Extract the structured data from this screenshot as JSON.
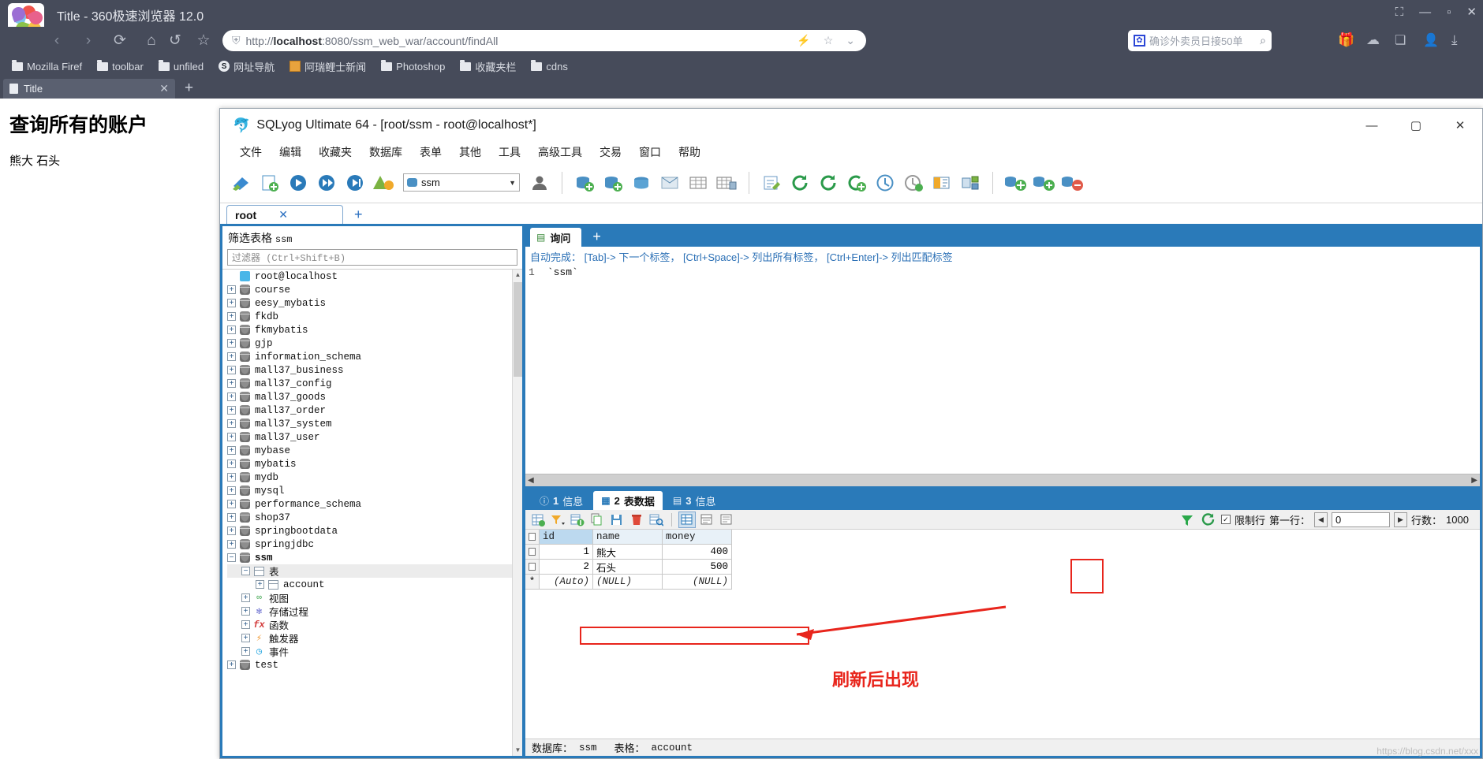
{
  "browser": {
    "window_title": "Title - 360极速浏览器 12.0",
    "nav": {
      "back": "‹",
      "forward": "›",
      "reload": "⟳",
      "home": "⌂",
      "undo": "↺",
      "star": "☆"
    },
    "url": {
      "scheme": "http://",
      "host": "localhost",
      "rest": ":8080/ssm_web_war/account/findAll"
    },
    "url_icons": {
      "lightning": "⚡",
      "star": "☆",
      "chevron": "⌄"
    },
    "search": {
      "placeholder": "确诊外卖员日接50单",
      "magnifier": "⌕"
    },
    "window_controls": {
      "screenshot": "⛶",
      "minimize": "—",
      "maximize": "▫",
      "close": "✕"
    },
    "bookmarks": [
      {
        "label": "Mozilla Firef",
        "icon": "folder-icon"
      },
      {
        "label": "toolbar",
        "icon": "folder-icon"
      },
      {
        "label": "unfiled",
        "icon": "folder-icon"
      },
      {
        "label": "网址导航",
        "icon": "compass-icon"
      },
      {
        "label": "阿瑞鲤士新闻",
        "icon": "news-icon"
      },
      {
        "label": "Photoshop",
        "icon": "folder-icon"
      },
      {
        "label": "收藏夹栏",
        "icon": "folder-icon"
      },
      {
        "label": "cdns",
        "icon": "folder-icon"
      }
    ],
    "tab": {
      "label": "Title",
      "close": "✕"
    },
    "new_tab": "+"
  },
  "page": {
    "heading": "查询所有的账户",
    "names": "熊大 石头"
  },
  "sqlyog": {
    "title": "SQLyog Ultimate 64 - [root/ssm - root@localhost*]",
    "window_controls": {
      "minimize": "—",
      "maximize": "▢",
      "close": "✕"
    },
    "menus": [
      "文件",
      "编辑",
      "收藏夹",
      "数据库",
      "表单",
      "其他",
      "工具",
      "高级工具",
      "交易",
      "窗口",
      "帮助"
    ],
    "db_selector": {
      "value": "ssm",
      "arrow": "▼"
    },
    "connection_tab": {
      "label": "root",
      "close": "✕"
    },
    "connection_new": "+",
    "tree": {
      "filter_label": "筛选表格",
      "filter_db": "ssm",
      "filter_placeholder": "过滤器 (Ctrl+Shift+B)",
      "root": "root@localhost",
      "databases": [
        "course",
        "eesy_mybatis",
        "fkdb",
        "fkmybatis",
        "gjp",
        "information_schema",
        "mall37_business",
        "mall37_config",
        "mall37_goods",
        "mall37_order",
        "mall37_system",
        "mall37_user",
        "mybase",
        "mybatis",
        "mydb",
        "mysql",
        "performance_schema",
        "shop37",
        "springbootdata",
        "springjdbc"
      ],
      "selected_db": "ssm",
      "ssm_children": [
        {
          "label": "表",
          "icon": "table-icon",
          "expanded": true
        },
        {
          "label": "视图",
          "icon": "view-icon",
          "expanded": false
        },
        {
          "label": "存储过程",
          "icon": "procedure-icon",
          "expanded": false
        },
        {
          "label": "函数",
          "icon": "function-icon",
          "expanded": false
        },
        {
          "label": "触发器",
          "icon": "trigger-icon",
          "expanded": false
        },
        {
          "label": "事件",
          "icon": "event-icon",
          "expanded": false
        }
      ],
      "tables": [
        "account"
      ],
      "after_ssm": [
        "test"
      ]
    },
    "query": {
      "tab_label": "询问",
      "new_tab": "+",
      "hint": "自动完成： [Tab]-> 下一个标签， [Ctrl+Space]-> 列出所有标签， [Ctrl+Enter]-> 列出匹配标签",
      "line_number": "1",
      "line_text": "`ssm`"
    },
    "results": {
      "tabs": [
        {
          "num": "1",
          "label": "信息",
          "icon": "info-icon",
          "active": false
        },
        {
          "num": "2",
          "label": "表数据",
          "icon": "grid-icon",
          "active": true
        },
        {
          "num": "3",
          "label": "信息",
          "icon": "info2-icon",
          "active": false
        }
      ],
      "limit_label": "限制行",
      "first_row_label": "第一行：",
      "first_row_value": "0",
      "rows_label": "行数：",
      "rows_value": "1000",
      "columns": [
        "id",
        "name",
        "money"
      ],
      "rows": [
        {
          "id": "1",
          "name": "熊大",
          "money": "400",
          "highlight": false
        },
        {
          "id": "2",
          "name": "石头",
          "money": "500",
          "highlight": true
        }
      ],
      "new_row": {
        "id": "(Auto)",
        "name": "(NULL)",
        "money": "(NULL)"
      },
      "new_row_marker": "*"
    },
    "status": {
      "db_label": "数据库：",
      "db_value": "ssm",
      "table_label": "表格：",
      "table_value": "account"
    }
  },
  "annotations": {
    "note": "刷新后出现",
    "accent": "#e8251c"
  },
  "watermark": "https://blog.csdn.net/xxx"
}
